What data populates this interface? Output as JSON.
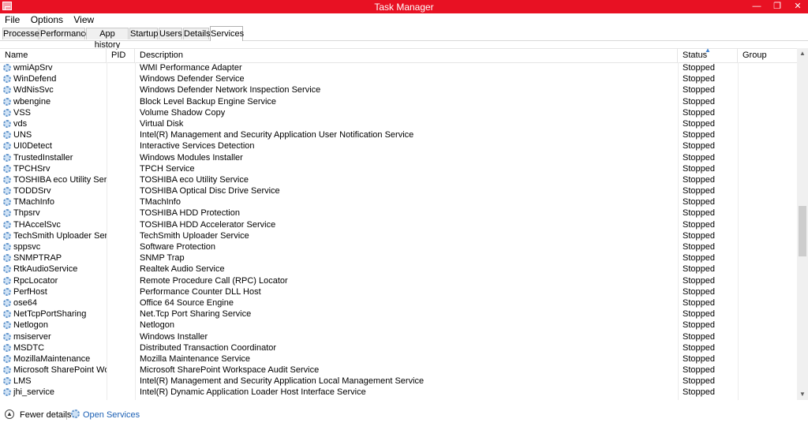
{
  "window": {
    "title": "Task Manager",
    "min_glyph": "—",
    "max_glyph": "❐",
    "close_glyph": "✕",
    "accent": "#e81123"
  },
  "menu": [
    "File",
    "Options",
    "View"
  ],
  "tabs": [
    "Processes",
    "Performance",
    "App history",
    "Startup",
    "Users",
    "Details",
    "Services"
  ],
  "active_tab": "Services",
  "columns": {
    "name": "Name",
    "pid": "PID",
    "description": "Description",
    "status": "Status",
    "group": "Group"
  },
  "sorted_column": "Status",
  "rows": [
    {
      "name": "wmiApSrv",
      "description": "WMI Performance Adapter",
      "status": "Stopped"
    },
    {
      "name": "WinDefend",
      "description": "Windows Defender Service",
      "status": "Stopped"
    },
    {
      "name": "WdNisSvc",
      "description": "Windows Defender Network Inspection Service",
      "status": "Stopped"
    },
    {
      "name": "wbengine",
      "description": "Block Level Backup Engine Service",
      "status": "Stopped"
    },
    {
      "name": "VSS",
      "description": "Volume Shadow Copy",
      "status": "Stopped"
    },
    {
      "name": "vds",
      "description": "Virtual Disk",
      "status": "Stopped"
    },
    {
      "name": "UNS",
      "description": "Intel(R) Management and Security Application User Notification Service",
      "status": "Stopped"
    },
    {
      "name": "UI0Detect",
      "description": "Interactive Services Detection",
      "status": "Stopped"
    },
    {
      "name": "TrustedInstaller",
      "description": "Windows Modules Installer",
      "status": "Stopped"
    },
    {
      "name": "TPCHSrv",
      "description": "TPCH Service",
      "status": "Stopped"
    },
    {
      "name": "TOSHIBA eco Utility Service",
      "description": "TOSHIBA eco Utility Service",
      "status": "Stopped"
    },
    {
      "name": "TODDSrv",
      "description": "TOSHIBA Optical Disc Drive Service",
      "status": "Stopped"
    },
    {
      "name": "TMachInfo",
      "description": "TMachInfo",
      "status": "Stopped"
    },
    {
      "name": "Thpsrv",
      "description": "TOSHIBA HDD Protection",
      "status": "Stopped"
    },
    {
      "name": "THAccelSvc",
      "description": "TOSHIBA HDD Accelerator Service",
      "status": "Stopped"
    },
    {
      "name": "TechSmith Uploader Service",
      "description": "TechSmith Uploader Service",
      "status": "Stopped"
    },
    {
      "name": "sppsvc",
      "description": "Software Protection",
      "status": "Stopped"
    },
    {
      "name": "SNMPTRAP",
      "description": "SNMP Trap",
      "status": "Stopped"
    },
    {
      "name": "RtkAudioService",
      "description": "Realtek Audio Service",
      "status": "Stopped"
    },
    {
      "name": "RpcLocator",
      "description": "Remote Procedure Call (RPC) Locator",
      "status": "Stopped"
    },
    {
      "name": "PerfHost",
      "description": "Performance Counter DLL Host",
      "status": "Stopped"
    },
    {
      "name": "ose64",
      "description": "Office 64 Source Engine",
      "status": "Stopped"
    },
    {
      "name": "NetTcpPortSharing",
      "description": "Net.Tcp Port Sharing Service",
      "status": "Stopped"
    },
    {
      "name": "Netlogon",
      "description": "Netlogon",
      "status": "Stopped"
    },
    {
      "name": "msiserver",
      "description": "Windows Installer",
      "status": "Stopped"
    },
    {
      "name": "MSDTC",
      "description": "Distributed Transaction Coordinator",
      "status": "Stopped"
    },
    {
      "name": "MozillaMaintenance",
      "description": "Mozilla Maintenance Service",
      "status": "Stopped"
    },
    {
      "name": "Microsoft SharePoint Work...",
      "description": "Microsoft SharePoint Workspace Audit Service",
      "status": "Stopped"
    },
    {
      "name": "LMS",
      "description": "Intel(R) Management and Security Application Local Management Service",
      "status": "Stopped"
    },
    {
      "name": "jhi_service",
      "description": "Intel(R) Dynamic Application Loader Host Interface Service",
      "status": "Stopped"
    }
  ],
  "footer": {
    "fewer_details": "Fewer details",
    "open_services": "Open Services"
  },
  "icons": {
    "service": "service-gear-icon",
    "fewer": "chevron-up-circle-icon",
    "open": "services-gear-icon"
  }
}
